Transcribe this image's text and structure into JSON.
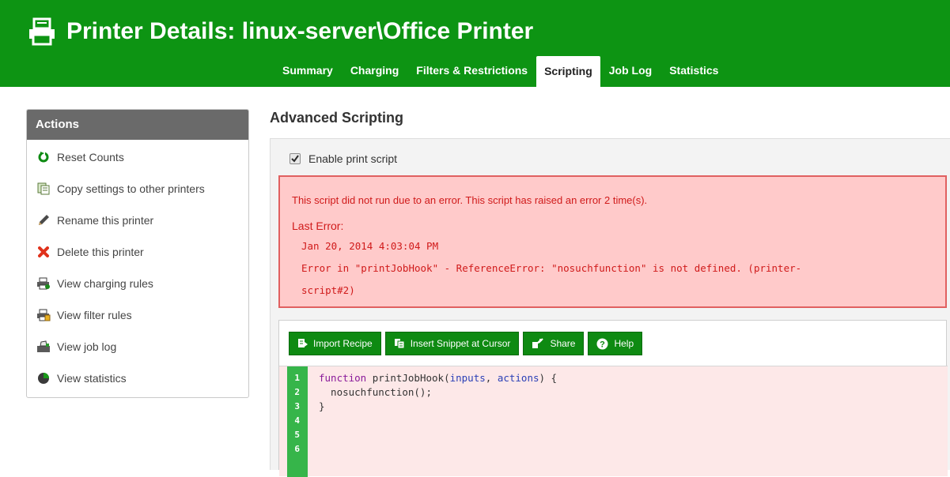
{
  "header": {
    "title": "Printer Details: linux-server\\Office Printer",
    "tabs": [
      {
        "label": "Summary",
        "active": false
      },
      {
        "label": "Charging",
        "active": false
      },
      {
        "label": "Filters & Restrictions",
        "active": false
      },
      {
        "label": "Scripting",
        "active": true
      },
      {
        "label": "Job Log",
        "active": false
      },
      {
        "label": "Statistics",
        "active": false
      }
    ]
  },
  "sidebar": {
    "header": "Actions",
    "items": [
      {
        "label": "Reset Counts",
        "icon": "reset-icon"
      },
      {
        "label": "Copy settings to other printers",
        "icon": "copy-icon"
      },
      {
        "label": "Rename this printer",
        "icon": "pencil-icon"
      },
      {
        "label": "Delete this printer",
        "icon": "delete-icon"
      },
      {
        "label": "View charging rules",
        "icon": "charging-icon"
      },
      {
        "label": "View filter rules",
        "icon": "filter-icon"
      },
      {
        "label": "View job log",
        "icon": "job-log-icon"
      },
      {
        "label": "View statistics",
        "icon": "pie-chart-icon"
      }
    ]
  },
  "main": {
    "title": "Advanced Scripting",
    "enable_label": "Enable print script",
    "enable_checked": true,
    "error": {
      "message": "This script did not run due to an error. This script has raised an error 2 time(s).",
      "last_error_label": "Last Error:",
      "timestamp": "Jan 20, 2014 4:03:04 PM",
      "detail_line1": "Error in \"printJobHook\" - ReferenceError: \"nosuchfunction\" is not defined. (printer-",
      "detail_line2": "script#2)"
    },
    "toolbar": {
      "import": "Import Recipe",
      "insert": "Insert Snippet at Cursor",
      "share": "Share",
      "help": "Help"
    },
    "code": {
      "line_numbers": [
        "1",
        "2",
        "3",
        "4",
        "5",
        "6"
      ],
      "line1_kw": "function",
      "line1_fn": "printJobHook",
      "line1_open": "(",
      "line1_p1": "inputs",
      "line1_comma": ", ",
      "line1_p2": "actions",
      "line1_close": ") {",
      "line2": "  nosuchfunction();",
      "line3": "}"
    }
  },
  "colors": {
    "header_green": "#0d9413",
    "button_green": "#0e8a12",
    "gutter_green": "#36b54a",
    "error_text": "#d01a1a",
    "error_bg": "#ffcaca",
    "error_border": "#e06060"
  }
}
